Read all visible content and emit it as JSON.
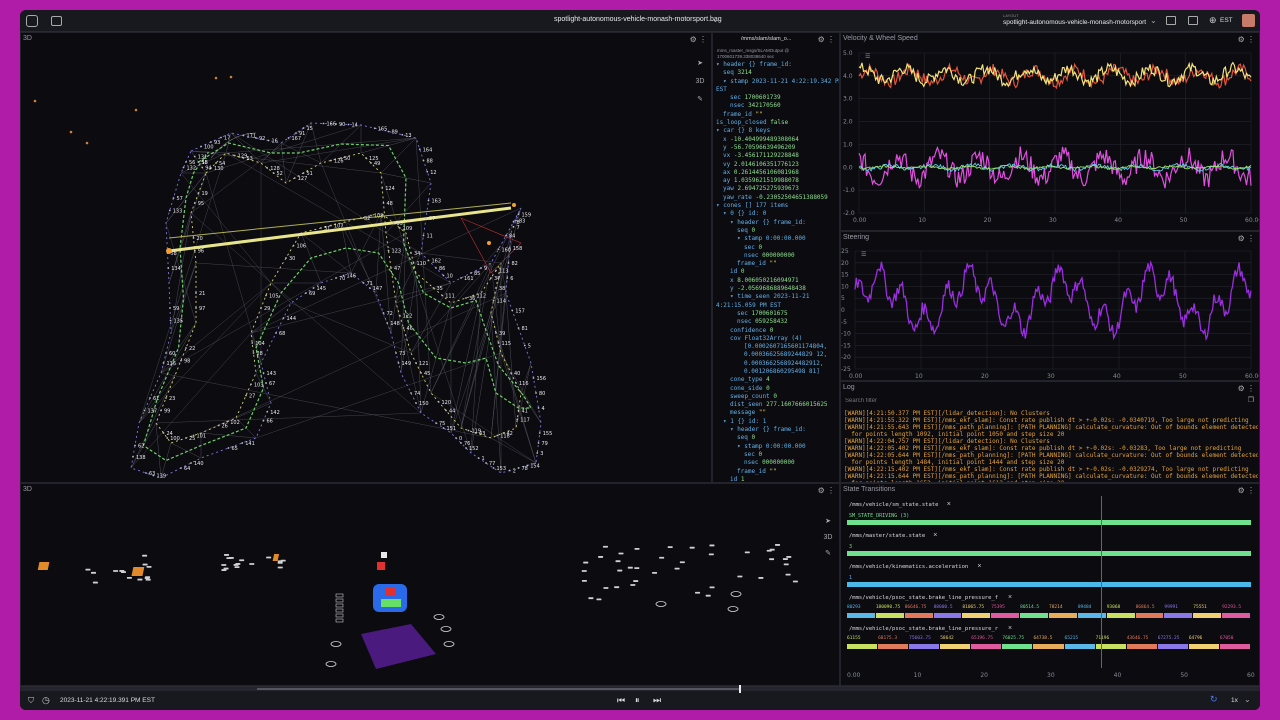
{
  "app": {
    "file_title": "spotlight-autonomous-vehicle-monash-motorsport.bag",
    "layout_caption": "LAYOUT",
    "layout_name": "spotlight-autonomous-vehicle-monash-motorsport",
    "timezone": "EST"
  },
  "panels": {
    "top3d_title": "3D",
    "bottom3d_title": "3D",
    "raw_topic": "/mms/slam/slam_o...",
    "raw_sub": "mms_master_msgs/SLAMOutput @\n1700601739.338038640 sec",
    "velocity_title": "Velocity & Wheel Speed",
    "steering_title": "Steering",
    "log_title": "Log",
    "log_filter_placeholder": "Search filter",
    "state_title": "State Transitions"
  },
  "raw_message": [
    {
      "i": 0,
      "k": "▾ header",
      "v": "{} frame_id:",
      "c": "tk"
    },
    {
      "i": 1,
      "k": "seq",
      "v": "3214",
      "c": "tv"
    },
    {
      "i": 1,
      "k": "▾ stamp",
      "v": "2023-11-21 4:22:19.342 PM",
      "c": "tk"
    },
    {
      "i": 0,
      "k": "EST",
      "v": "",
      "c": "tk"
    },
    {
      "i": 2,
      "k": "sec",
      "v": "1700601739",
      "c": "tv"
    },
    {
      "i": 2,
      "k": "nsec",
      "v": "342170560",
      "c": "tv"
    },
    {
      "i": 1,
      "k": "frame_id",
      "v": "\"\"",
      "c": "tn"
    },
    {
      "i": 0,
      "k": "is_loop_closed",
      "v": "false",
      "c": "tv"
    },
    {
      "i": 0,
      "k": "▾ car",
      "v": "{} 8 keys",
      "c": "tk"
    },
    {
      "i": 1,
      "k": "x",
      "v": "-10.404999489308064",
      "c": "tv"
    },
    {
      "i": 1,
      "k": "y",
      "v": "-56.70596639496209",
      "c": "tv"
    },
    {
      "i": 1,
      "k": "vx",
      "v": "-3.456171129228848",
      "c": "tv"
    },
    {
      "i": 1,
      "k": "vy",
      "v": "2.0146106351776123",
      "c": "tv"
    },
    {
      "i": 1,
      "k": "ax",
      "v": "0.2614456106081968",
      "c": "tv"
    },
    {
      "i": 1,
      "k": "ay",
      "v": "1.0359621519988078",
      "c": "tv"
    },
    {
      "i": 1,
      "k": "yaw",
      "v": "2.694725275939673",
      "c": "tv"
    },
    {
      "i": 1,
      "k": "yaw_rate",
      "v": "-0.23052504651388059",
      "c": "tv"
    },
    {
      "i": 0,
      "k": "▾ cones",
      "v": "[] 177 items",
      "c": "tk"
    },
    {
      "i": 1,
      "k": "▾ 0",
      "v": "{} id: 0",
      "c": "tk"
    },
    {
      "i": 2,
      "k": "▾ header",
      "v": "{} frame_id:",
      "c": "tk"
    },
    {
      "i": 3,
      "k": "seq",
      "v": "0",
      "c": "tv"
    },
    {
      "i": 3,
      "k": "▾ stamp",
      "v": "0:00:00.000",
      "c": "tk"
    },
    {
      "i": 4,
      "k": "sec",
      "v": "0",
      "c": "tv"
    },
    {
      "i": 4,
      "k": "nsec",
      "v": "000000000",
      "c": "tv"
    },
    {
      "i": 3,
      "k": "frame_id",
      "v": "\"\"",
      "c": "tn"
    },
    {
      "i": 2,
      "k": "id",
      "v": "0",
      "c": "tv"
    },
    {
      "i": 2,
      "k": "x",
      "v": "8.006050216094971",
      "c": "tv"
    },
    {
      "i": 2,
      "k": "y",
      "v": "-2.0569686889648438",
      "c": "tv"
    },
    {
      "i": 2,
      "k": "▾ time_seen",
      "v": "2023-11-21",
      "c": "tk"
    },
    {
      "i": 0,
      "k": "4:21:15.059 PM EST",
      "v": "",
      "c": "tk"
    },
    {
      "i": 3,
      "k": "sec",
      "v": "1700601675",
      "c": "tv"
    },
    {
      "i": 3,
      "k": "nsec",
      "v": "059258432",
      "c": "tv"
    },
    {
      "i": 2,
      "k": "confidence",
      "v": "0",
      "c": "tv"
    },
    {
      "i": 2,
      "k": "cov",
      "v": "Float32Array (4)",
      "c": "tk"
    },
    {
      "i": 4,
      "k": "",
      "v": "[0.0002607165601174804,",
      "c": "tk"
    },
    {
      "i": 4,
      "k": "",
      "v": "0.00036625689244829 12,",
      "c": "tk"
    },
    {
      "i": 4,
      "k": "",
      "v": "0.0003662568924482912,",
      "c": "tk"
    },
    {
      "i": 4,
      "k": "",
      "v": "0.001206860295498 81]",
      "c": "tk"
    },
    {
      "i": 2,
      "k": "cone_type",
      "v": "4",
      "c": "tv"
    },
    {
      "i": 2,
      "k": "cone_side",
      "v": "0",
      "c": "tv"
    },
    {
      "i": 2,
      "k": "sweep_count",
      "v": "0",
      "c": "tv"
    },
    {
      "i": 2,
      "k": "dist_seen",
      "v": "277.1607666015625",
      "c": "tv"
    },
    {
      "i": 2,
      "k": "message",
      "v": "\"\"",
      "c": "tn"
    },
    {
      "i": 1,
      "k": "▾ 1",
      "v": "{} id: 1",
      "c": "tk"
    },
    {
      "i": 2,
      "k": "▾ header",
      "v": "{} frame_id:",
      "c": "tk"
    },
    {
      "i": 3,
      "k": "seq",
      "v": "0",
      "c": "tv"
    },
    {
      "i": 3,
      "k": "▾ stamp",
      "v": "0:00:00.000",
      "c": "tk"
    },
    {
      "i": 4,
      "k": "sec",
      "v": "0",
      "c": "tv"
    },
    {
      "i": 4,
      "k": "nsec",
      "v": "000000000",
      "c": "tv"
    },
    {
      "i": 3,
      "k": "frame_id",
      "v": "\"\"",
      "c": "tn"
    },
    {
      "i": 2,
      "k": "id",
      "v": "1",
      "c": "tv"
    }
  ],
  "velocity_chart": {
    "y_ticks": [
      "5.0",
      "4.0",
      "3.0",
      "2.0",
      "1.0",
      "0.0",
      "-1.0",
      "-2.0"
    ],
    "x_ticks": [
      "0.00",
      "10",
      "20",
      "30",
      "40",
      "50",
      "60.00"
    ],
    "series_colors": [
      "#e0543a",
      "#f2e37a",
      "#e14fe0",
      "#5ed0e8",
      "#9be06a"
    ]
  },
  "steering_chart": {
    "y_ticks": [
      "25",
      "20",
      "15",
      "10",
      "5",
      "0",
      "-5",
      "-10",
      "-15",
      "-20",
      "-25"
    ],
    "x_ticks": [
      "0.00",
      "10",
      "20",
      "30",
      "40",
      "50",
      "60.00"
    ],
    "color": "#9b2ee0"
  },
  "log_lines": [
    "[WARN][4:21:50.377 PM EST][/lidar_detection]: No Clusters",
    "[WARN][4:21:55.322 PM EST][/mms_ekf_slam]: Const rate publish dt > +-0.02s: -0.0340719, Too large not predicting",
    "[WARN][4:21:55.643 PM EST][/mms_path_planning]: [PATH PLANNING] calculate_curvature: Out of bounds element detected",
    "  for points length 1092, initial point 1050 and step size 20",
    "[WARN][4:22:04.757 PM EST][/lidar_detection]: No Clusters",
    "[WARN][4:22:05.402 PM EST][/mms_ekf_slam]: Const rate publish dt > +-0.02s: -0.03283, Too large not predicting",
    "[WARN][4:22:05.644 PM EST][/mms_path_planning]: [PATH PLANNING] calculate_curvature: Out of bounds element detected",
    "  for points length 1484, initial point 1444 and step size 20",
    "[WARN][4:22:15.402 PM EST][/mms_ekf_slam]: Const rate publish dt > +-0.02s: -0.0329274, Too large not predicting",
    "[WARN][4:22:15.644 PM EST][/mms_path_planning]: [PATH PLANNING] calculate_curvature: Out of bounds element detected",
    "  for points length 1652, initial point 1612 and step size 20"
  ],
  "state_rows": [
    {
      "label": "/mms/vehicle/sm_state.state",
      "value": "SM_STATE_DRIVING (3)",
      "color": "#6ee08e"
    },
    {
      "label": "/mms/master/state.state",
      "value": "3",
      "color": "#6ee08e"
    },
    {
      "label": "/mms/vehicle/kinematics.acceleration",
      "value": "1",
      "color": "#4ab8e8"
    },
    {
      "label": "/mms/vehicle/psoc_state.brake_line_pressure_f",
      "value": "80293",
      "color": "#e05aa0",
      "values": [
        "80293",
        "180090.75",
        "86646.75",
        "88000.5",
        "81065.75",
        "75395",
        "80514.5",
        "78214",
        "89484",
        "93068",
        "86864.5",
        "99991",
        "75551",
        "92293.5"
      ]
    },
    {
      "label": "/mms/vehicle/psoc_state.brake_line_pressure_r",
      "value": "61155",
      "color": "#9be06a",
      "values": [
        "61155",
        "68175.3",
        "75603.75",
        "58642",
        "65196.75",
        "76025.75",
        "64738.5",
        "65215",
        "71196",
        "43646.75",
        "67275.25",
        "64796",
        "67050"
      ]
    }
  ],
  "state_x_ticks": [
    "0.00",
    "10",
    "20",
    "30",
    "40",
    "50",
    "60"
  ],
  "playback": {
    "timestamp": "2023-11-21 4:22:19.391 PM EST",
    "speed": "1x",
    "progress": 0.58
  },
  "cone_labels_top": [
    "100",
    "171",
    "167",
    "166",
    "165",
    "164",
    "163",
    "162",
    "161",
    "160",
    "159",
    "158",
    "157",
    "156",
    "155",
    "154",
    "153",
    "152",
    "151",
    "150",
    "149",
    "148",
    "147",
    "146",
    "145",
    "144",
    "143",
    "142",
    "141",
    "140",
    "139",
    "138",
    "137",
    "136",
    "135",
    "134",
    "133",
    "132",
    "131",
    "130",
    "129",
    "128",
    "127",
    "126",
    "125",
    "124",
    "123",
    "122",
    "121",
    "120",
    "119",
    "118",
    "117",
    "116",
    "115",
    "114",
    "113",
    "112",
    "111",
    "110",
    "109",
    "108",
    "107",
    "106",
    "105",
    "104",
    "103",
    "102",
    "101",
    "100",
    "99",
    "98",
    "97",
    "96",
    "95",
    "94",
    "93",
    "92",
    "91",
    "90",
    "89",
    "88",
    "87",
    "86",
    "85",
    "84",
    "83",
    "82",
    "81",
    "80",
    "79",
    "78",
    "77",
    "76",
    "75",
    "74",
    "73",
    "72",
    "71",
    "70",
    "69",
    "68",
    "67",
    "66",
    "65",
    "64",
    "63",
    "62",
    "61",
    "60",
    "59",
    "58",
    "57",
    "56",
    "55",
    "54",
    "53",
    "52",
    "51",
    "50",
    "49",
    "48",
    "47",
    "46",
    "45",
    "44",
    "43",
    "42",
    "41",
    "40",
    "39",
    "38",
    "37",
    "36",
    "35",
    "34",
    "33",
    "32",
    "31",
    "30",
    "29",
    "28",
    "27",
    "26",
    "25",
    "24",
    "23",
    "22",
    "21",
    "20",
    "19",
    "18",
    "17",
    "16",
    "15",
    "14",
    "13",
    "12",
    "11",
    "10",
    "9",
    "8",
    "7",
    "6",
    "5",
    "4",
    "3",
    "2",
    "1",
    "0"
  ],
  "colors": {
    "accent": "#b01ca8",
    "bg": "#0b0b10",
    "track_yellow": "#e9e58a",
    "track_green": "#6ed068",
    "car_blue": "#2a6ae8"
  }
}
